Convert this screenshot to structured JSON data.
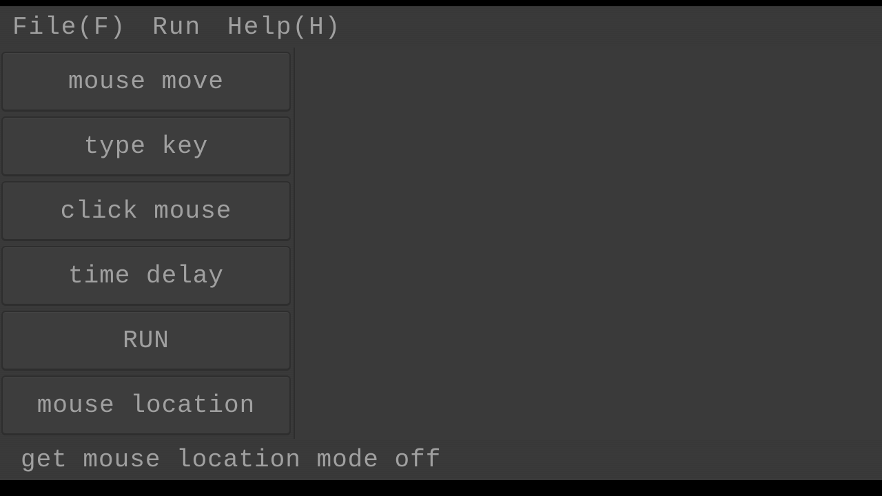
{
  "menu": {
    "file": "File(F)",
    "run": "Run",
    "help": "Help(H)"
  },
  "sidebar": {
    "buttons": {
      "mouse_move": "mouse move",
      "type_key": "type key",
      "click_mouse": "click mouse",
      "time_delay": "time delay",
      "run": "RUN",
      "mouse_location": "mouse location"
    }
  },
  "status": {
    "text": "get mouse location mode off"
  }
}
